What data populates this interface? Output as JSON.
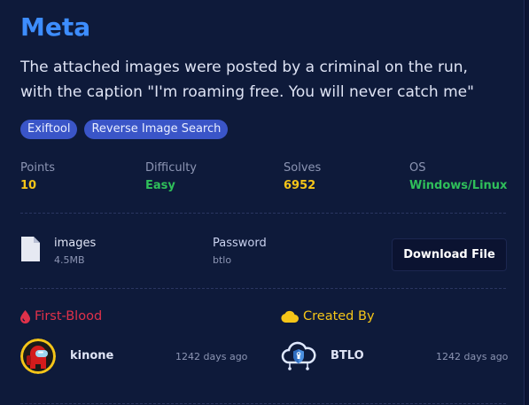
{
  "challenge": {
    "title": "Meta",
    "description": "The attached images were posted by a criminal on the run, with the caption \"I'm roaming free. You will never catch me\"",
    "tags": [
      "Exiftool",
      "Reverse Image Search"
    ]
  },
  "stats": {
    "points": {
      "label": "Points",
      "value": "10",
      "color": "#f5c518"
    },
    "difficulty": {
      "label": "Difficulty",
      "value": "Easy",
      "color": "#2fbf5a"
    },
    "solves": {
      "label": "Solves",
      "value": "6952",
      "color": "#f5c518"
    },
    "os": {
      "label": "OS",
      "value": "Windows/Linux",
      "color": "#2fbf5a"
    }
  },
  "file": {
    "name": "images",
    "size": "4.5MB",
    "password_label": "Password",
    "password_value": "btlo",
    "download_label": "Download File",
    "icon": "file-icon"
  },
  "first_blood": {
    "heading": "First-Blood",
    "icon": "blood-drop-icon",
    "user": "kinone",
    "time": "1242 days ago"
  },
  "created_by": {
    "heading": "Created By",
    "icon": "cloud-icon",
    "user": "BTLO",
    "time": "1242 days ago"
  }
}
